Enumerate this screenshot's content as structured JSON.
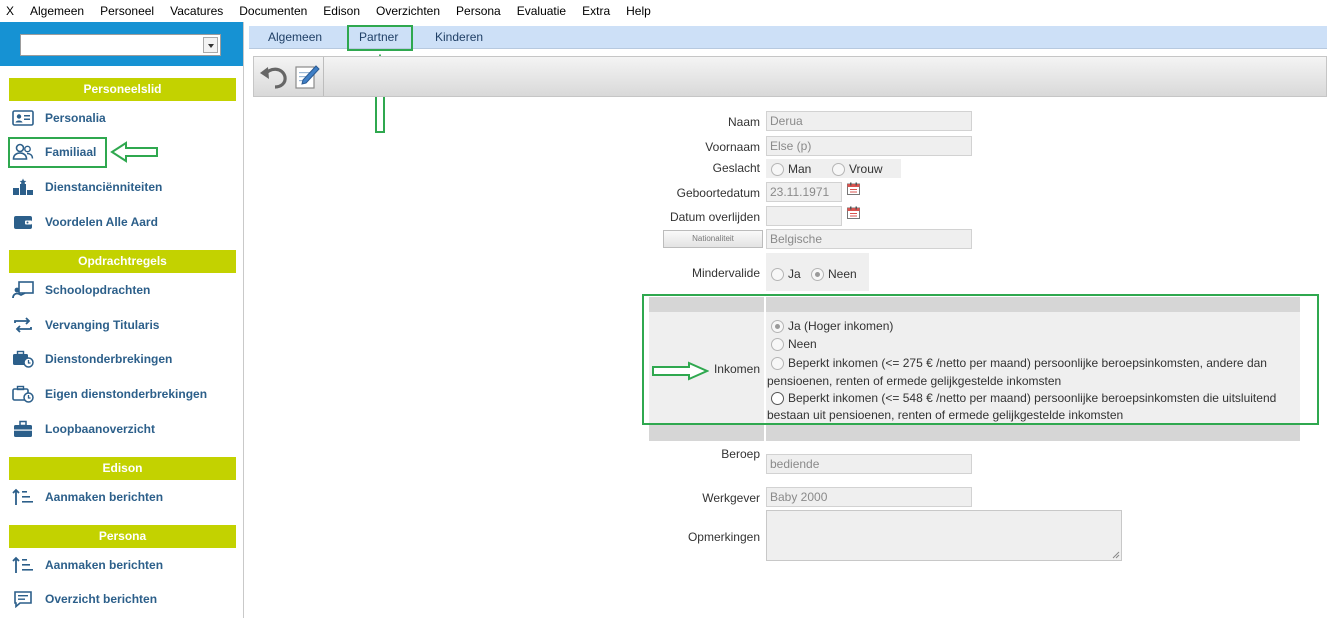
{
  "menu": [
    "X",
    "Algemeen",
    "Personeel",
    "Vacatures",
    "Documenten",
    "Edison",
    "Overzichten",
    "Persona",
    "Evaluatie",
    "Extra",
    "Help"
  ],
  "sidebar": {
    "select_value": "",
    "sections": [
      {
        "title": "Personeelslid",
        "items": [
          "Personalia",
          "Familiaal",
          "Dienstanciënniteiten",
          "Voordelen Alle Aard"
        ]
      },
      {
        "title": "Opdrachtregels",
        "items": [
          "Schoolopdrachten",
          "Vervanging Titularis",
          "Dienstonderbrekingen",
          "Eigen dienstonderbrekingen",
          "Loopbaanoverzicht"
        ]
      },
      {
        "title": "Edison",
        "items": [
          "Aanmaken berichten"
        ]
      },
      {
        "title": "Persona",
        "items": [
          "Aanmaken berichten",
          "Overzicht berichten"
        ]
      }
    ]
  },
  "tabs": [
    "Algemeen",
    "Partner",
    "Kinderen"
  ],
  "form": {
    "naam_label": "Naam",
    "naam_value": "Derua",
    "voornaam_label": "Voornaam",
    "voornaam_value": "Else (p)",
    "geslacht_label": "Geslacht",
    "man": "Man",
    "vrouw": "Vrouw",
    "geboortedatum_label": "Geboortedatum",
    "geboortedatum_value": "23.11.1971",
    "overlijden_label": "Datum overlijden",
    "overlijden_value": "",
    "nationaliteit_button": "Nationaliteit",
    "nationaliteit_value": "Belgische",
    "mindervalide_label": "Mindervalide",
    "ja": "Ja",
    "neen": "Neen",
    "inkomen_label": "Inkomen",
    "inkomen_options": [
      "Ja (Hoger inkomen)",
      "Neen",
      "Beperkt inkomen (<= 275 € /netto per maand) persoonlijke beroepsinkomsten, andere dan",
      "pensioenen, renten of ermede gelijkgestelde inkomsten",
      "Beperkt inkomen (<= 548 € /netto per maand) persoonlijke beroepsinkomsten die uitsluitend",
      "bestaan uit pensioenen, renten of ermede gelijkgestelde inkomsten"
    ],
    "beroep_label": "Beroep",
    "beroep_value": "bediende",
    "werkgever_label": "Werkgever",
    "werkgever_value": "Baby 2000",
    "opmerkingen_label": "Opmerkingen",
    "opmerkingen_value": ""
  },
  "colors": {
    "accent": "#1692d3",
    "section": "#c3d200",
    "tabbar": "#cde0f7",
    "annotation": "#2fa84f"
  }
}
